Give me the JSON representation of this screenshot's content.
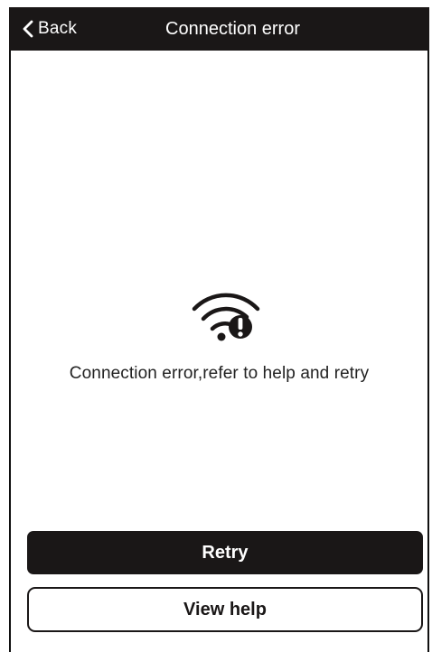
{
  "header": {
    "back_label": "Back",
    "title": "Connection error",
    "back_icon": "chevron-left-icon"
  },
  "main": {
    "status_icon": "wifi-error-icon",
    "message": "Connection error,refer to help and retry"
  },
  "actions": {
    "retry_label": "Retry",
    "view_help_label": "View help"
  },
  "colors": {
    "header_bg": "#1a1717",
    "primary_button_bg": "#1a1717",
    "primary_button_text": "#ffffff",
    "secondary_button_border": "#1a1717",
    "background": "#ffffff"
  }
}
